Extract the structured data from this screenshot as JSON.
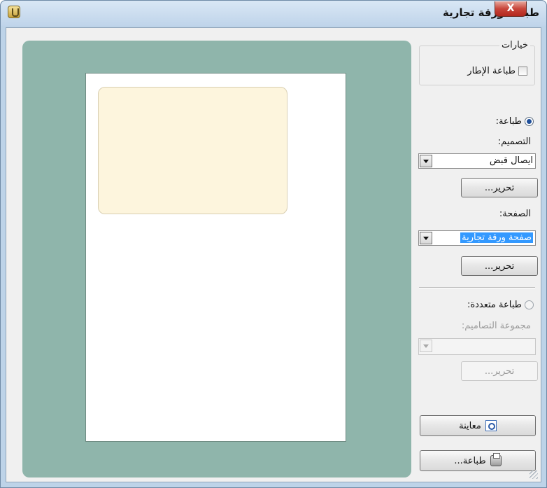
{
  "window": {
    "title": "طباعة ورقة تجارية",
    "close_label": "X"
  },
  "icons": {
    "app": "app-icon",
    "close": "close-icon",
    "preview": "preview-icon",
    "printer": "printer-icon",
    "dropdown_arrow": "chevron-down-icon"
  },
  "options": {
    "legend": "خيارات",
    "print_frame_label": "طباعة الإطار",
    "print_frame_checked": false
  },
  "single_print": {
    "radio_label": "طباعة:",
    "selected": true,
    "design_label": "التصميم:",
    "design_value": "ايصال قبض",
    "design_edit_label": "تحرير...",
    "page_label": "الصفحة:",
    "page_value": "صفحة ورقة تجارية",
    "page_edit_label": "تحرير..."
  },
  "multi_print": {
    "radio_label": "طباعة متعددة:",
    "selected": false,
    "group_label": "مجموعة التصاميم:",
    "group_value": "",
    "edit_label": "تحرير..."
  },
  "actions": {
    "preview_label": "معاينة",
    "print_label": "طباعة..."
  },
  "colors": {
    "preview_bg": "#8fb5ab",
    "card_fill": "#fdf5dd",
    "selection": "#3399ff"
  }
}
